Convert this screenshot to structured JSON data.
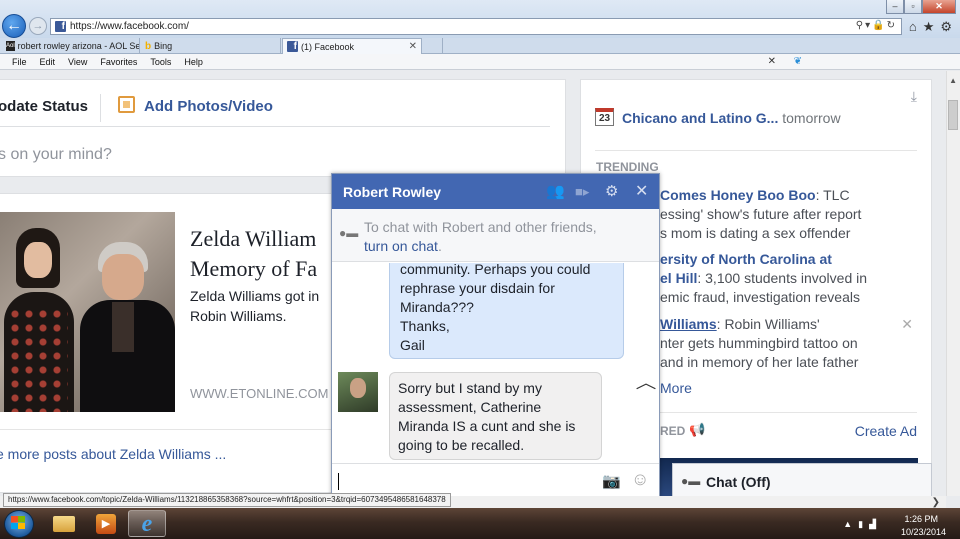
{
  "browser": {
    "url": "https://www.facebook.com/",
    "tabs": [
      {
        "label": "robert rowley arizona - AOL Se..."
      },
      {
        "label": "Bing"
      },
      {
        "label": "(1) Facebook"
      }
    ],
    "menu": [
      "File",
      "Edit",
      "View",
      "Favorites",
      "Tools",
      "Help"
    ],
    "status_url": "https://www.facebook.com/topic/Zelda-Williams/113218865358368?source=whfrt&position=3&trqid=6073495486581648378"
  },
  "composer": {
    "tab_status": "odate Status",
    "tab_photo": "Add Photos/Video",
    "placeholder": "s on your mind?"
  },
  "post": {
    "title_line1": "Zelda William",
    "title_line2": "Memory of Fa",
    "desc_line1": "Zelda Williams got in",
    "desc_line2": "Robin Williams.",
    "source": "WWW.ETONLINE.COM",
    "more_link": "e more posts about Zelda Williams ..."
  },
  "sidebar": {
    "event_day": "23",
    "event_name": "Chicano and Latino G...",
    "event_time": "tomorrow",
    "trending_header": "TRENDING",
    "trends": [
      {
        "topic": "Comes Honey Boo Boo",
        "text_line1": ": TLC",
        "text_line2": "essing' show's future after report",
        "text_line3": "s mom is dating a sex offender"
      },
      {
        "topic": "ersity of North Carolina at",
        "topic_line2": "el Hill",
        "text_line2": ": 3,100 students involved in",
        "text_line3": "emic fraud, investigation reveals"
      },
      {
        "topic": "Williams",
        "text_line1": ": Robin Williams'",
        "text_line2": "nter gets hummingbird tattoo on",
        "text_line3": "and in memory of her late father"
      }
    ],
    "see_more": "More",
    "sponsored_label": "RED",
    "create_ad": "Create Ad"
  },
  "chat": {
    "name": "Robert Rowley",
    "notice_line1": "To chat with Robert and other friends,",
    "notice_link": "turn on chat",
    "notice_end": ".",
    "outgoing_message": "community. Perhaps you could\nrephrase your disdain for\nMiranda???\nThanks,\nGail",
    "incoming_message": "Sorry but I stand by my assessment, Catherine Miranda IS a cunt and she is going to be recalled.",
    "bar_label": "Chat (Off)"
  },
  "taskbar": {
    "time": "1:26 PM",
    "date": "10/23/2014"
  },
  "colors": {
    "facebook_blue": "#4267b2",
    "link_blue": "#365899",
    "outgoing_bubble": "#dbe9fc"
  }
}
